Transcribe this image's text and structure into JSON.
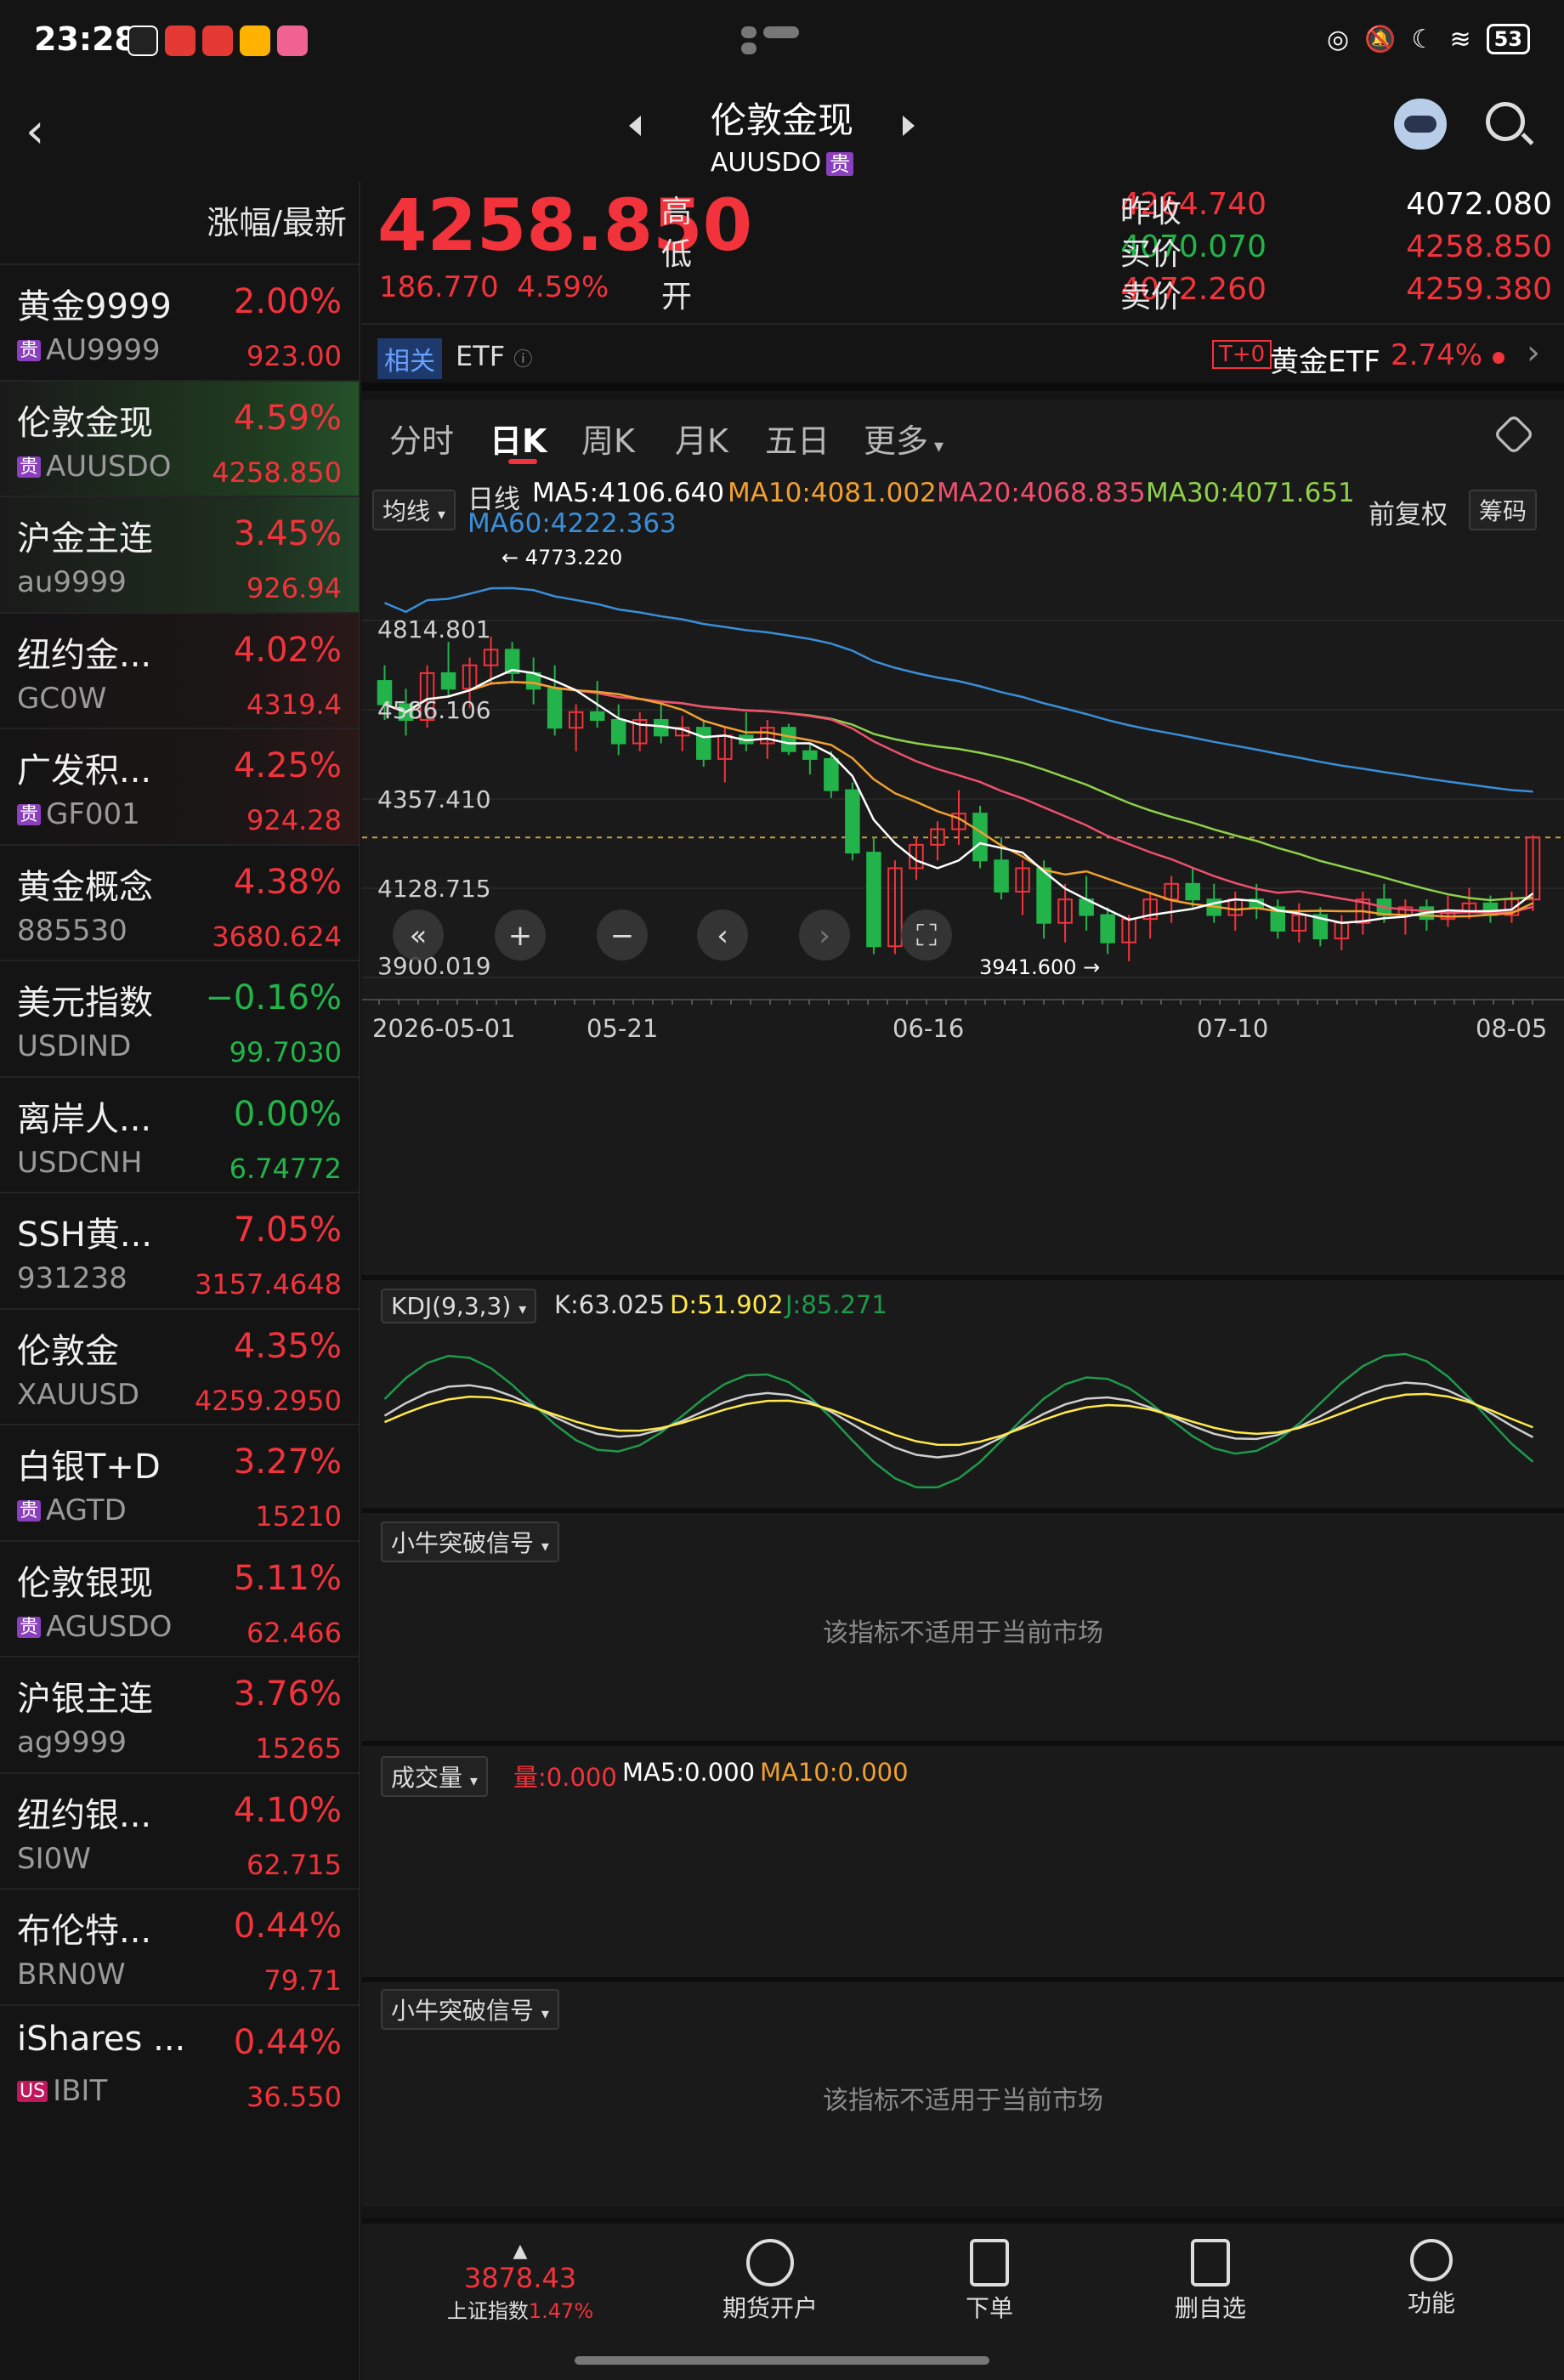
{
  "status_bar": {
    "time": "23:28",
    "battery": "53"
  },
  "header": {
    "title": "伦敦金现",
    "subtitle": "AUUSDO",
    "tag": "贵"
  },
  "watchlist": {
    "header": "涨幅/最新",
    "items": [
      {
        "name": "黄金9999",
        "code": "AU9999",
        "tag": "贵",
        "pct": "2.00%",
        "price": "923.00",
        "trend": "up"
      },
      {
        "name": "伦敦金现",
        "code": "AUUSDO",
        "tag": "贵",
        "pct": "4.59%",
        "price": "4258.850",
        "trend": "up"
      },
      {
        "name": "沪金主连",
        "code": "au9999",
        "tag": "",
        "pct": "3.45%",
        "price": "926.94",
        "trend": "up"
      },
      {
        "name": "纽约金...",
        "code": "GC0W",
        "tag": "",
        "pct": "4.02%",
        "price": "4319.4",
        "trend": "up"
      },
      {
        "name": "广发积...",
        "code": "GF001",
        "tag": "贵",
        "pct": "4.25%",
        "price": "924.28",
        "trend": "up"
      },
      {
        "name": "黄金概念",
        "code": "885530",
        "tag": "",
        "pct": "4.38%",
        "price": "3680.624",
        "trend": "up"
      },
      {
        "name": "美元指数",
        "code": "USDIND",
        "tag": "",
        "pct": "−0.16%",
        "price": "99.7030",
        "trend": "down"
      },
      {
        "name": "离岸人...",
        "code": "USDCNH",
        "tag": "",
        "pct": "0.00%",
        "price": "6.74772",
        "trend": "down"
      },
      {
        "name": "SSH黄...",
        "code": "931238",
        "tag": "",
        "pct": "7.05%",
        "price": "3157.4648",
        "trend": "up"
      },
      {
        "name": "伦敦金",
        "code": "XAUUSD",
        "tag": "",
        "pct": "4.35%",
        "price": "4259.2950",
        "trend": "up"
      },
      {
        "name": "白银T+D",
        "code": "AGTD",
        "tag": "贵",
        "pct": "3.27%",
        "price": "15210",
        "trend": "up"
      },
      {
        "name": "伦敦银现",
        "code": "AGUSDO",
        "tag": "贵",
        "pct": "5.11%",
        "price": "62.466",
        "trend": "up"
      },
      {
        "name": "沪银主连",
        "code": "ag9999",
        "tag": "",
        "pct": "3.76%",
        "price": "15265",
        "trend": "up"
      },
      {
        "name": "纽约银...",
        "code": "SI0W",
        "tag": "",
        "pct": "4.10%",
        "price": "62.715",
        "trend": "up"
      },
      {
        "name": "布伦特...",
        "code": "BRN0W",
        "tag": "",
        "pct": "0.44%",
        "price": "79.71",
        "trend": "up"
      },
      {
        "name": "iShares ...",
        "code": "IBIT",
        "tag": "US",
        "pct": "0.44%",
        "price": "36.550",
        "trend": "up"
      }
    ]
  },
  "quote": {
    "last": "4258.850",
    "change": "186.770",
    "change_pct": "4.59%",
    "labels": {
      "high": "高",
      "low": "低",
      "open": "开",
      "prev_close": "昨收",
      "bid": "买价",
      "ask": "卖价"
    },
    "high": "4264.740",
    "low": "4070.070",
    "open": "4072.260",
    "prev_close": "4072.080",
    "bid": "4258.850",
    "ask": "4259.380"
  },
  "etf_bar": {
    "related": "相关",
    "etf": "ETF",
    "t0": "T+0",
    "gold_etf": "黄金ETF",
    "gold_etf_pct": "2.74%"
  },
  "tabs": [
    "分时",
    "日K",
    "周K",
    "月K",
    "五日",
    "更多"
  ],
  "active_tab": "日K",
  "ma_row": {
    "avg_label": "均线",
    "daily": "日线",
    "ma5": "MA5:4106.640",
    "ma10": "MA10:4081.002",
    "ma20": "MA20:4068.835",
    "ma30": "MA30:4071.651",
    "ma60": "MA60:4222.363",
    "adjust": "前复权",
    "chips": "筹码"
  },
  "colors": {
    "up": "#f2333c",
    "down": "#22b44a",
    "ma5": "#ffffff",
    "ma10": "#f0a030",
    "ma20": "#f0506e",
    "ma30": "#8ed04a",
    "ma60": "#3a8ed8"
  },
  "chart_data": {
    "type": "candlestick",
    "y_labels": [
      "4814.801",
      "4586.106",
      "4357.410",
      "4128.715",
      "3900.019"
    ],
    "ylim": [
      3900.019,
      4814.801
    ],
    "x_labels": [
      "2026-05-01",
      "05-21",
      "06-16",
      "07-10",
      "08-05"
    ],
    "annotations": {
      "max": "4773.220",
      "min": "3941.600"
    },
    "candles": [
      [
        4660,
        4700,
        4560,
        4600
      ],
      [
        4600,
        4640,
        4520,
        4560
      ],
      [
        4560,
        4700,
        4540,
        4680
      ],
      [
        4680,
        4760,
        4620,
        4640
      ],
      [
        4640,
        4720,
        4590,
        4700
      ],
      [
        4700,
        4773.22,
        4650,
        4740
      ],
      [
        4740,
        4760,
        4660,
        4680
      ],
      [
        4680,
        4720,
        4600,
        4640
      ],
      [
        4640,
        4700,
        4520,
        4540
      ],
      [
        4540,
        4600,
        4480,
        4580
      ],
      [
        4580,
        4660,
        4540,
        4560
      ],
      [
        4560,
        4600,
        4470,
        4500
      ],
      [
        4500,
        4580,
        4480,
        4560
      ],
      [
        4560,
        4600,
        4500,
        4520
      ],
      [
        4520,
        4570,
        4480,
        4540
      ],
      [
        4540,
        4560,
        4440,
        4460
      ],
      [
        4460,
        4540,
        4400,
        4520
      ],
      [
        4520,
        4580,
        4480,
        4500
      ],
      [
        4500,
        4560,
        4460,
        4540
      ],
      [
        4540,
        4550,
        4470,
        4480
      ],
      [
        4480,
        4500,
        4420,
        4460
      ],
      [
        4460,
        4480,
        4360,
        4380
      ],
      [
        4380,
        4400,
        4200,
        4220
      ],
      [
        4220,
        4260,
        3960,
        3980
      ],
      [
        3980,
        4200,
        3960,
        4180
      ],
      [
        4180,
        4260,
        4150,
        4240
      ],
      [
        4240,
        4300,
        4200,
        4280
      ],
      [
        4280,
        4380,
        4240,
        4320
      ],
      [
        4320,
        4340,
        4180,
        4200
      ],
      [
        4200,
        4260,
        4100,
        4120
      ],
      [
        4120,
        4200,
        4060,
        4180
      ],
      [
        4180,
        4200,
        4000,
        4040
      ],
      [
        4040,
        4140,
        3990,
        4100
      ],
      [
        4100,
        4160,
        4020,
        4060
      ],
      [
        4060,
        4080,
        3960,
        3990
      ],
      [
        3990,
        4060,
        3941.6,
        4050
      ],
      [
        4050,
        4120,
        4000,
        4100
      ],
      [
        4100,
        4160,
        4040,
        4140
      ],
      [
        4140,
        4180,
        4080,
        4100
      ],
      [
        4100,
        4140,
        4040,
        4060
      ],
      [
        4060,
        4120,
        4020,
        4100
      ],
      [
        4100,
        4140,
        4050,
        4080
      ],
      [
        4080,
        4100,
        4000,
        4020
      ],
      [
        4020,
        4090,
        3990,
        4060
      ],
      [
        4060,
        4080,
        3980,
        4000
      ],
      [
        4000,
        4060,
        3970,
        4040
      ],
      [
        4040,
        4120,
        4010,
        4100
      ],
      [
        4100,
        4140,
        4040,
        4060
      ],
      [
        4060,
        4100,
        4010,
        4080
      ],
      [
        4080,
        4100,
        4020,
        4050
      ],
      [
        4050,
        4110,
        4030,
        4070
      ],
      [
        4070,
        4130,
        4050,
        4090
      ],
      [
        4090,
        4110,
        4040,
        4060
      ],
      [
        4060,
        4120,
        4040,
        4100
      ],
      [
        4100,
        4264.74,
        4070,
        4258.85
      ]
    ]
  },
  "kdj": {
    "label": "KDJ(9,3,3)",
    "k": "K:63.025",
    "d": "D:51.902",
    "j": "J:85.271"
  },
  "panels": {
    "signal1": {
      "label": "小牛突破信号",
      "msg": "该指标不适用于当前市场"
    },
    "volume": {
      "label": "成交量",
      "vol": "量:0.000",
      "ma5": "MA5:0.000",
      "ma10": "MA10:0.000"
    },
    "signal2": {
      "label": "小牛突破信号",
      "msg": "该指标不适用于当前市场"
    }
  },
  "bottom_nav": {
    "index_value": "3878.43",
    "index_name": "上证指数",
    "index_pct": "1.47%",
    "futures": "期货开户",
    "order": "下单",
    "remove": "删自选",
    "functions": "功能"
  }
}
